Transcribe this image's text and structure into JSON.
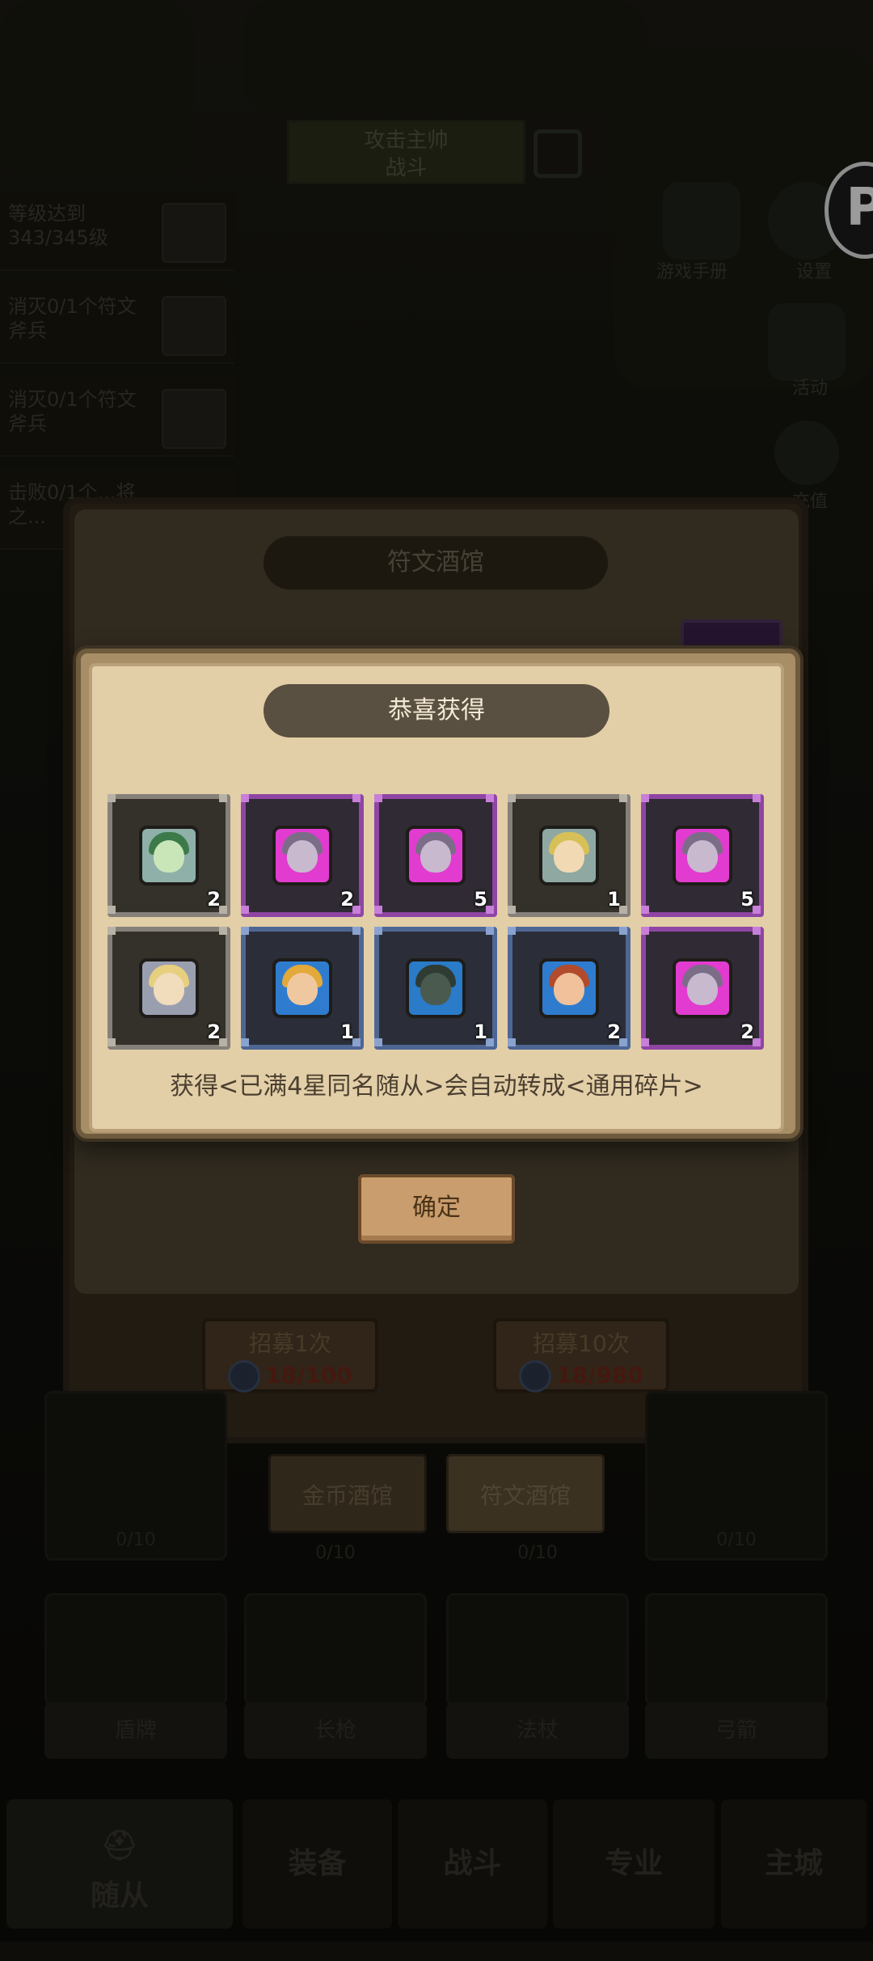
{
  "background": {
    "banner_text": [
      "攻击主帅",
      "战斗"
    ],
    "quests": [
      {
        "text": "等级达到343/345级"
      },
      {
        "text": "消灭0/1个符文斧兵"
      },
      {
        "text": "消灭0/1个符文斧兵"
      },
      {
        "text": "击败0/1个...将之..."
      }
    ],
    "side_buttons": [
      "游戏手册",
      "设置",
      "活动",
      "充值"
    ],
    "logo_letter": "P"
  },
  "tavern": {
    "title": "符文酒馆",
    "recruit_once": {
      "label": "招募1次",
      "cost": "18/100"
    },
    "recruit_ten": {
      "label": "招募10次",
      "cost": "18/980"
    },
    "tabs": [
      {
        "label": "金币酒馆",
        "selected": false
      },
      {
        "label": "符文酒馆",
        "selected": true
      }
    ],
    "slot_counts": [
      "0/10",
      "0/10",
      "0/10",
      "0/10"
    ],
    "slot_labels": [
      "盾牌",
      "长枪",
      "法杖",
      "弓箭"
    ]
  },
  "nav": {
    "items": [
      "随从",
      "装备",
      "战斗",
      "专业",
      "主城"
    ]
  },
  "popup": {
    "title": "恭喜获得",
    "note": "获得<已满4星同名随从>会自动转成<通用碎片>",
    "confirm_label": "确定",
    "rewards": [
      {
        "rarity": "gray",
        "count": "2",
        "icon": "green-horned-hero-icon"
      },
      {
        "rarity": "purple",
        "count": "2",
        "icon": "purple-hooded-hero-icon"
      },
      {
        "rarity": "purple",
        "count": "5",
        "icon": "purple-hooded-hero-icon"
      },
      {
        "rarity": "gray",
        "count": "1",
        "icon": "blonde-elf-hero-icon"
      },
      {
        "rarity": "purple",
        "count": "5",
        "icon": "purple-hooded-hero-icon"
      },
      {
        "rarity": "gray",
        "count": "2",
        "icon": "blonde-knight-hero-icon"
      },
      {
        "rarity": "blue",
        "count": "1",
        "icon": "bearded-dwarf-hero-icon"
      },
      {
        "rarity": "blue",
        "count": "1",
        "icon": "green-eyed-rogue-hero-icon"
      },
      {
        "rarity": "blue",
        "count": "2",
        "icon": "red-haired-archer-hero-icon"
      },
      {
        "rarity": "purple",
        "count": "2",
        "icon": "purple-hooded-hero-icon"
      }
    ],
    "colors": {
      "gray_border": "#858079",
      "purple_border": "#8f45a4",
      "blue_border": "#4e6694",
      "parchment": "#e3cfa7"
    }
  }
}
